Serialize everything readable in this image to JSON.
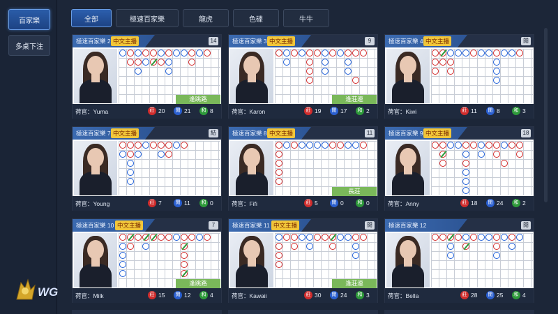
{
  "sidebar": {
    "active_label": "百家樂",
    "multi_label": "多桌下注",
    "logo_text": "WG"
  },
  "tabs": [
    "全部",
    "極速百家樂",
    "龍虎",
    "色碟",
    "牛牛"
  ],
  "badges": {
    "banker": "莊",
    "player": "閒",
    "tie": "和"
  },
  "dealer_prefix": "荷官：",
  "colors": {
    "banker": "#d22a2a",
    "player": "#1f5fd8",
    "tie": "#2e9a3a",
    "accent": "#2c5fae",
    "tag": "#f1c63a"
  },
  "tables": [
    {
      "name": "極速百家樂 2",
      "tag": "中文主播",
      "count": "14",
      "dealer": "Yuma",
      "banker": "20",
      "player": "21",
      "tie": "8",
      "predict": "逢跳路"
    },
    {
      "name": "極速百家樂 3",
      "tag": "中文主播",
      "count": "9",
      "dealer": "Karon",
      "banker": "19",
      "player": "17",
      "tie": "2",
      "predict": "逢莊連"
    },
    {
      "name": "極速百家樂 4",
      "tag": "中文主播",
      "count": "閒",
      "dealer": "Kiwi",
      "banker": "11",
      "player": "8",
      "tie": "3",
      "predict": ""
    },
    {
      "name": "極速百家樂 7",
      "tag": "中文主播",
      "count": "結",
      "dealer": "Young",
      "banker": "7",
      "player": "11",
      "tie": "0",
      "predict": ""
    },
    {
      "name": "極速百家樂 8",
      "tag": "中文主播",
      "count": "11",
      "dealer": "Fifi",
      "banker": "5",
      "player": "0",
      "tie": "0",
      "predict": "長莊"
    },
    {
      "name": "極速百家樂 9",
      "tag": "中文主播",
      "count": "18",
      "dealer": "Anny",
      "banker": "18",
      "player": "24",
      "tie": "2",
      "predict": ""
    },
    {
      "name": "極速百家樂 10",
      "tag": "中文主播",
      "count": "7",
      "dealer": "Milk",
      "banker": "15",
      "player": "12",
      "tie": "4",
      "predict": "逢跳路"
    },
    {
      "name": "極速百家樂 11",
      "tag": "中文主播",
      "count": "閒",
      "dealer": "Kawaii",
      "banker": "30",
      "player": "24",
      "tie": "3",
      "predict": "逢莊連"
    },
    {
      "name": "極速百家樂 12",
      "tag": "",
      "count": "閒",
      "dealer": "Bella",
      "banker": "28",
      "player": "25",
      "tie": "4",
      "predict": ""
    }
  ]
}
